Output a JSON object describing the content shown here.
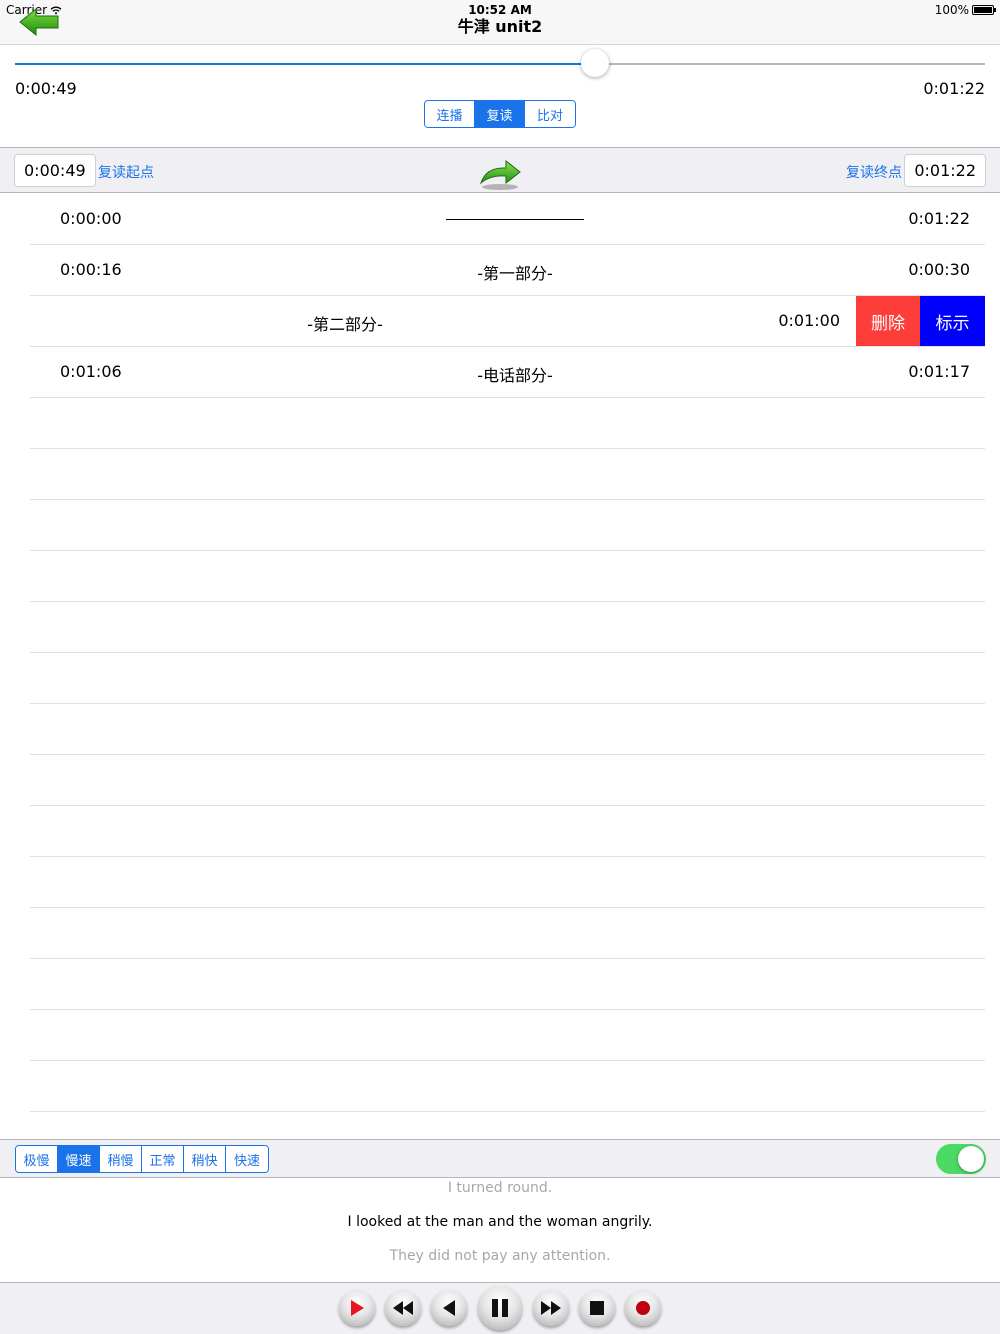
{
  "status": {
    "carrier": "Carrier",
    "time": "10:52 AM",
    "battery": "100%"
  },
  "nav": {
    "title": "牛津 unit2"
  },
  "progress": {
    "current": "0:00:49",
    "total": "0:01:22",
    "fraction": 0.5976
  },
  "mode": {
    "options": [
      "连播",
      "复读",
      "比对"
    ],
    "selected": 1
  },
  "repeat": {
    "start_time": "0:00:49",
    "start_label": "复读起点",
    "end_label": "复读终点",
    "end_time": "0:01:22"
  },
  "segments": [
    {
      "start": "0:00:00",
      "title": "",
      "end": "0:01:22"
    },
    {
      "start": "0:00:16",
      "title": "-第一部分-",
      "end": "0:00:30"
    },
    {
      "start": "",
      "title": "-第二部分-",
      "end": "0:01:00"
    },
    {
      "start": "0:01:06",
      "title": "-电话部分-",
      "end": "0:01:17"
    }
  ],
  "row_actions": {
    "delete": "删除",
    "mark": "标示"
  },
  "speed": {
    "options": [
      "极慢",
      "慢速",
      "稍慢",
      "正常",
      "稍快",
      "快速"
    ],
    "selected": 1
  },
  "toggle": {
    "on": true
  },
  "lyrics": {
    "previous": "I turned round.",
    "current": "I looked at the man and the woman angrily.",
    "next": "They did not pay any attention."
  },
  "colors": {
    "accent": "#1a73e8",
    "delete": "#fc3d39",
    "mark": "#0000fe",
    "toggle_on": "#4cd964"
  }
}
